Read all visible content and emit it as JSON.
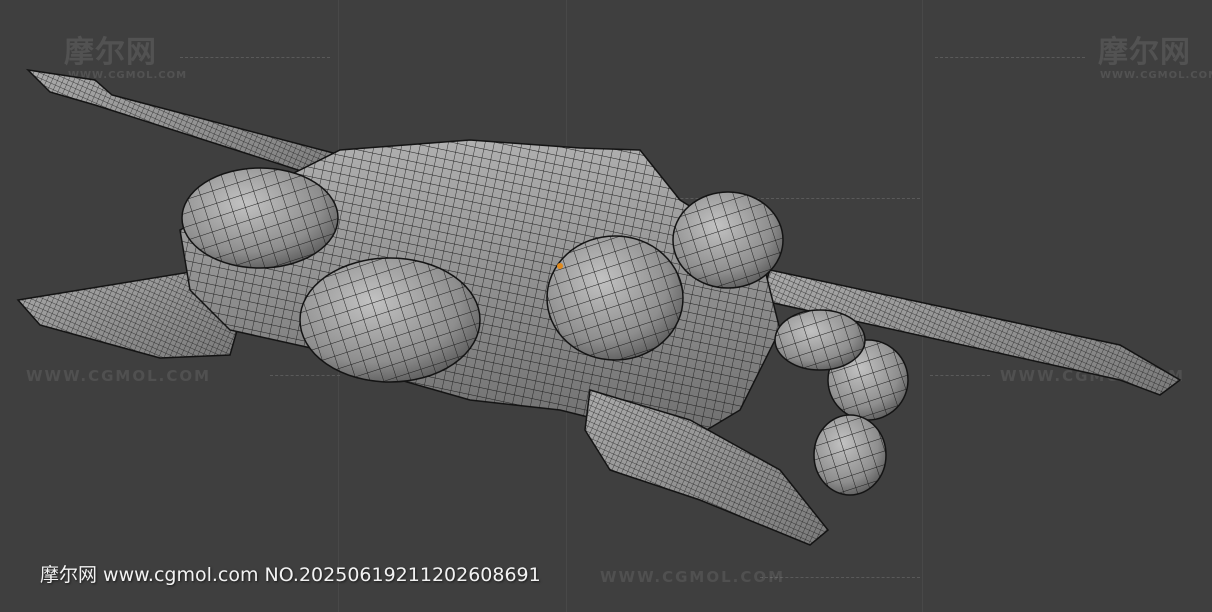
{
  "watermark": {
    "logo_text": "摩尔网",
    "logo_subtext": "WWW.CGMOL.COM",
    "url_text": "WWW.CGMOL.COM"
  },
  "caption": {
    "text": "摩尔网 www.cgmol.com NO.20250619211202608691"
  },
  "colors": {
    "background": "#3f3f3f",
    "mesh_fill": "#9a9a9a",
    "wire": "#1e1e1e",
    "origin_marker": "#e08a1e"
  },
  "icons": {
    "model": "spaceship-wireframe-mesh"
  }
}
